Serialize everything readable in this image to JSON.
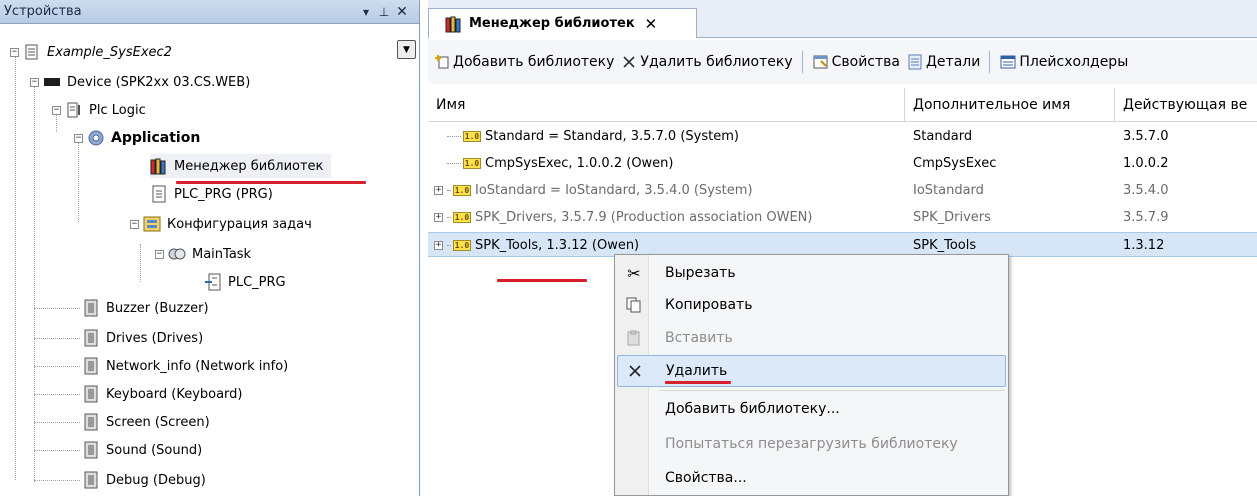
{
  "devices_panel": {
    "title": "Устройства",
    "controls": {
      "dropdown": "▾",
      "pin": "⊥",
      "close": "✕"
    },
    "tree": [
      {
        "key": "project",
        "label": "Example_SysExec2"
      },
      {
        "key": "device",
        "label": "Device (SPK2xx 03.CS.WEB)"
      },
      {
        "key": "plc_logic",
        "label": "Plc Logic"
      },
      {
        "key": "application",
        "label": "Application"
      },
      {
        "key": "lib_manager",
        "label": "Менеджер библиотек"
      },
      {
        "key": "plc_prg",
        "label": "PLC_PRG (PRG)"
      },
      {
        "key": "task_config",
        "label": "Конфигурация задач"
      },
      {
        "key": "main_task",
        "label": "MainTask"
      },
      {
        "key": "main_task_prg",
        "label": "PLC_PRG"
      },
      {
        "key": "buzzer",
        "label": "Buzzer (Buzzer)"
      },
      {
        "key": "drives",
        "label": "Drives (Drives)"
      },
      {
        "key": "network_info",
        "label": "Network_info (Network info)"
      },
      {
        "key": "keyboard",
        "label": "Keyboard (Keyboard)"
      },
      {
        "key": "screen",
        "label": "Screen (Screen)"
      },
      {
        "key": "sound",
        "label": "Sound (Sound)"
      },
      {
        "key": "debug",
        "label": "Debug (Debug)"
      }
    ]
  },
  "editor": {
    "tab_label": "Менеджер библиотек",
    "toolbar": {
      "add_library": "Добавить библиотеку",
      "remove_library": "Удалить библиотеку",
      "properties": "Свойства",
      "details": "Детали",
      "placeholders": "Плейсхолдеры"
    },
    "columns": [
      "Имя",
      "Дополнительное имя",
      "Действующая ве"
    ],
    "libraries": [
      {
        "name": "Standard = Standard, 3.5.7.0 (System)",
        "namespace": "Standard",
        "version": "3.5.7.0",
        "expandable": false,
        "muted": false,
        "selected": false
      },
      {
        "name": "CmpSysExec, 1.0.0.2 (Owen)",
        "namespace": "CmpSysExec",
        "version": "1.0.0.2",
        "expandable": false,
        "muted": false,
        "selected": false
      },
      {
        "name": "IoStandard = IoStandard, 3.5.4.0 (System)",
        "namespace": "IoStandard",
        "version": "3.5.4.0",
        "expandable": true,
        "muted": true,
        "selected": false
      },
      {
        "name": "SPK_Drivers, 3.5.7.9 (Production association OWEN)",
        "namespace": "SPK_Drivers",
        "version": "3.5.7.9",
        "expandable": true,
        "muted": true,
        "selected": false
      },
      {
        "name": "SPK_Tools, 1.3.12 (Owen)",
        "namespace": "SPK_Tools",
        "version": "1.3.12",
        "expandable": true,
        "muted": false,
        "selected": true
      }
    ],
    "library_icon_text": "1.0"
  },
  "context_menu": {
    "items": {
      "cut": "Вырезать",
      "copy": "Копировать",
      "paste": "Вставить",
      "delete": "Удалить",
      "add_library": "Добавить библиотеку...",
      "reload_library": "Попытаться перезагрузить библиотеку",
      "properties": "Свойства..."
    }
  }
}
